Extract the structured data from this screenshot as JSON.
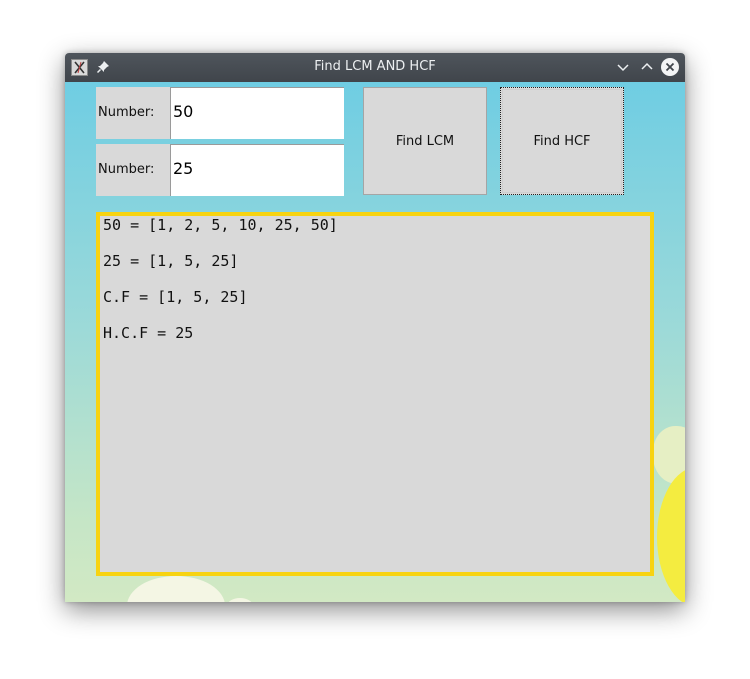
{
  "window": {
    "title": "Find LCM AND HCF",
    "icons": [
      "app-icon",
      "pin-icon",
      "chevron-down-icon",
      "chevron-up-icon",
      "close-icon"
    ]
  },
  "form": {
    "number1_label": "Number:",
    "number1_value": "50",
    "number2_label": "Number:",
    "number2_value": "25"
  },
  "buttons": {
    "find_lcm": "Find LCM",
    "find_hcf": "Find HCF"
  },
  "output": {
    "lines": [
      "50 = [1, 2, 5, 10, 25, 50]",
      "25 = [1, 5, 25]",
      "C.F = [1, 5, 25]",
      "H.C.F = 25"
    ]
  },
  "colors": {
    "output_border": "#f7d311",
    "background_top": "#6fcde3",
    "background_bottom": "#d2e9c4",
    "titlebar": "#464b51"
  }
}
